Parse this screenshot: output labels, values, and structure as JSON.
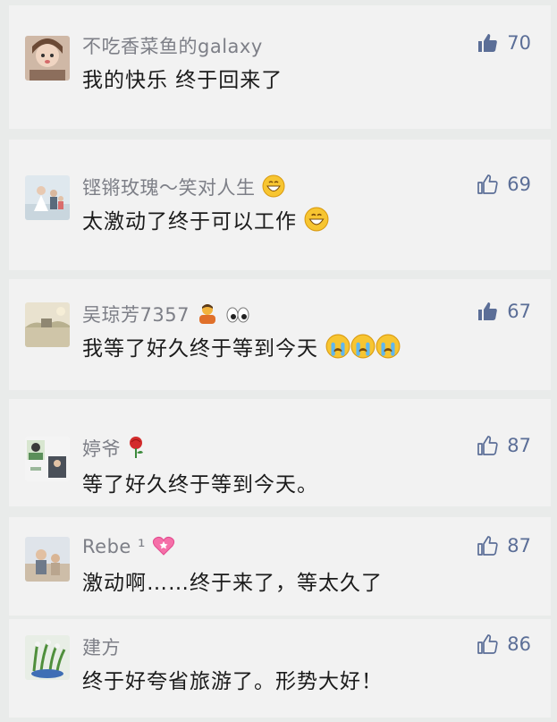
{
  "comments": [
    {
      "user": "不吃香菜鱼的galaxy",
      "text": "我的快乐 终于回来了",
      "likes": "70",
      "liked": true,
      "avatar": "avatar-girl-photo"
    },
    {
      "user": "铿锵玫瑰～笑对人生",
      "user_emoji": "grinning-face-icon",
      "text": "太激动了终于可以工作",
      "text_emoji": "grinning-face-icon",
      "likes": "69",
      "liked": false,
      "avatar": "avatar-family-photo"
    },
    {
      "user": "吴琼芳7357",
      "user_emoji": [
        "person-bowing-icon",
        "eyes-icon"
      ],
      "text": "我等了好久终于等到今天",
      "text_emoji": [
        "crying-face-icon",
        "crying-face-icon",
        "crying-face-icon"
      ],
      "likes": "67",
      "liked": true,
      "avatar": "avatar-landscape-photo"
    },
    {
      "user": "婷爷",
      "user_emoji": "rose-icon",
      "text": "等了好久终于等到今天。",
      "likes": "87",
      "liked": false,
      "avatar": "avatar-collage-photo"
    },
    {
      "user": "Rebe ¹",
      "user_emoji": "heart-icon",
      "text": "激动啊……终于来了，等太久了",
      "likes": "87",
      "liked": false,
      "avatar": "avatar-people-photo"
    },
    {
      "user": "建方",
      "text": "终于好夸省旅游了。形势大好！",
      "likes": "86",
      "liked": false,
      "avatar": "avatar-plant-photo"
    }
  ],
  "colors": {
    "name": "#7d7f87",
    "like": "#5b6e97",
    "text": "#1b1b1b",
    "card": "#f2f2f2"
  }
}
